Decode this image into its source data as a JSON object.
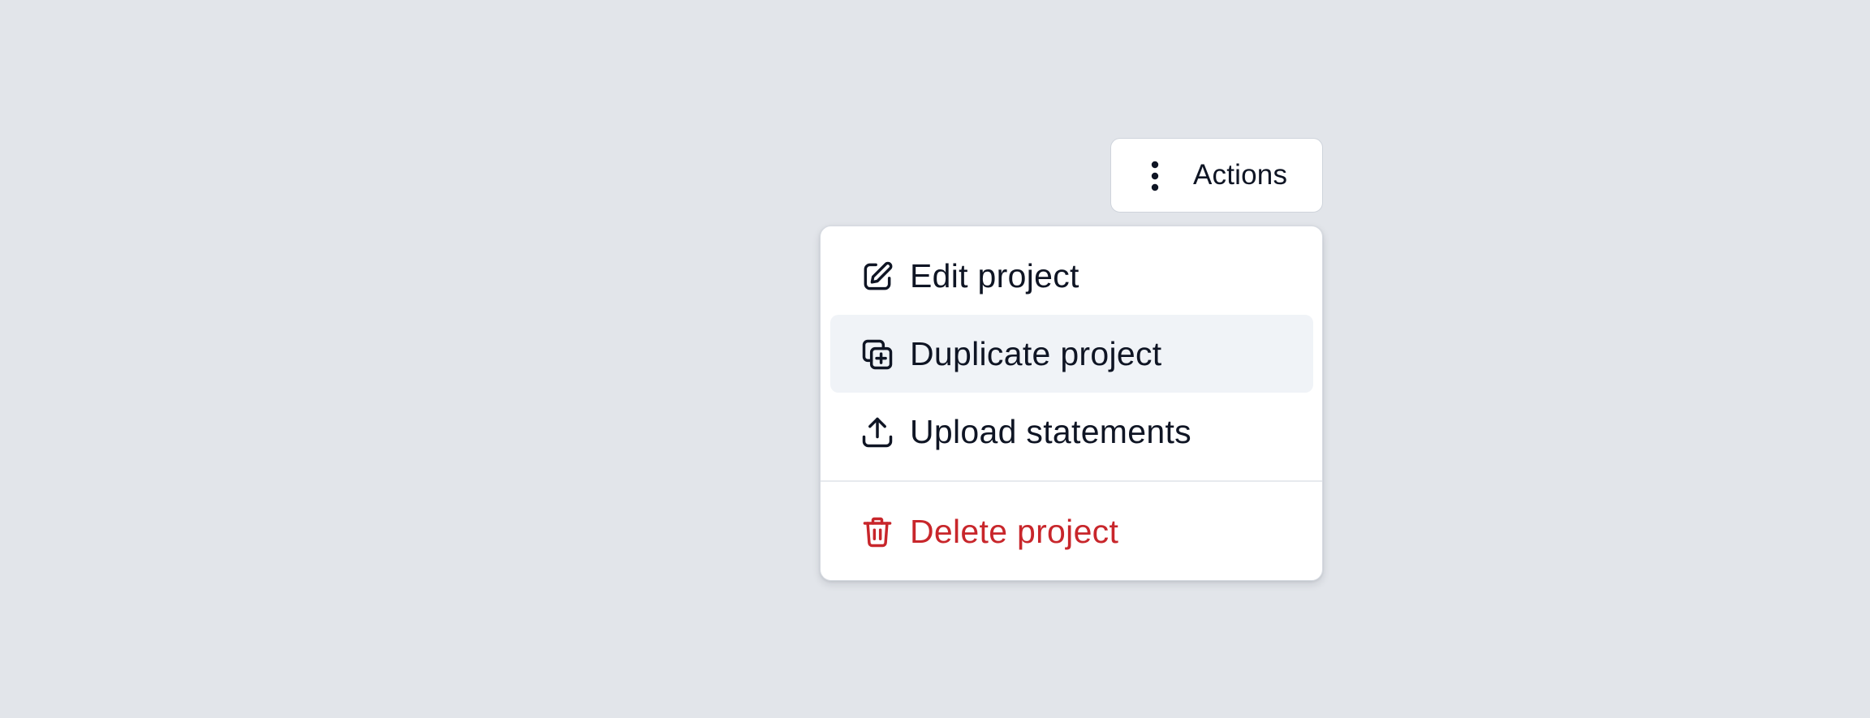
{
  "actions_button": {
    "label": "Actions",
    "icon": "more-vertical-icon"
  },
  "menu": {
    "items": [
      {
        "label": "Edit project",
        "icon": "edit-icon",
        "highlighted": false
      },
      {
        "label": "Duplicate project",
        "icon": "duplicate-icon",
        "highlighted": true
      },
      {
        "label": "Upload statements",
        "icon": "upload-icon",
        "highlighted": false
      },
      {
        "label": "Delete project",
        "icon": "trash-icon",
        "danger": true
      }
    ]
  },
  "colors": {
    "background": "#e2e5ea",
    "text": "#0f1524",
    "danger": "#c8262b",
    "highlight": "#f0f3f7",
    "surface": "#ffffff"
  }
}
